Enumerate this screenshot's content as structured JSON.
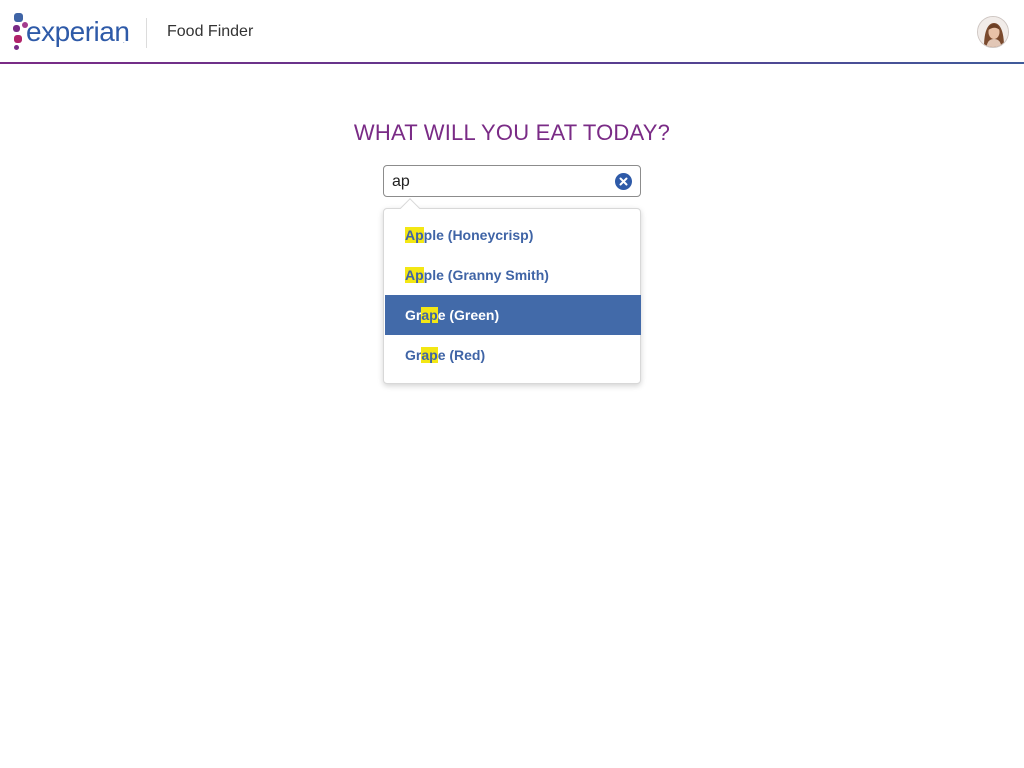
{
  "header": {
    "logo_text": "experian",
    "logo_tm": ".",
    "app_title": "Food Finder"
  },
  "main": {
    "headline": "WHAT WILL YOU EAT TODAY?"
  },
  "search": {
    "value": "ap",
    "placeholder": ""
  },
  "suggestions": [
    {
      "before": "",
      "match": "Ap",
      "after": "ple (Honeycrisp)",
      "selected": false
    },
    {
      "before": "",
      "match": "Ap",
      "after": "ple (Granny Smith)",
      "selected": false
    },
    {
      "before": "Gr",
      "match": "ap",
      "after": "e (Green)",
      "selected": true
    },
    {
      "before": "Gr",
      "match": "ap",
      "after": "e (Red)",
      "selected": false
    }
  ],
  "colors": {
    "brand_purple": "#7a2b86",
    "brand_blue": "#2e5aa8",
    "selected_row": "#426aa9",
    "highlight": "#f3e714"
  },
  "icons": {
    "clear": "clear-circle-x-icon",
    "avatar": "user-avatar"
  }
}
